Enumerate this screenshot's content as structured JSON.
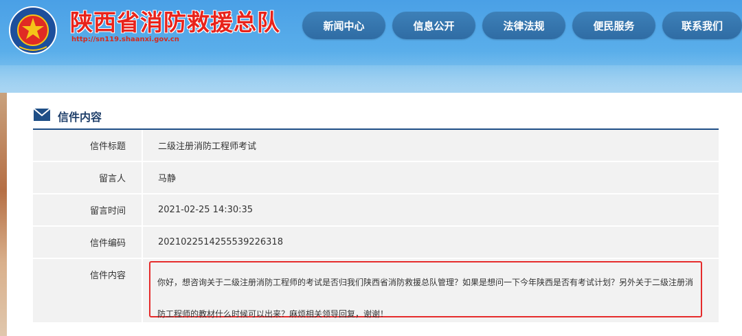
{
  "header": {
    "title": "陕西省消防救援总队",
    "url": "http://sn119.shaanxi.gov.cn",
    "emblem_text": "中国消防救援 CHINA FIRE AND RESCUE"
  },
  "nav": {
    "items": [
      "新闻中心",
      "信息公开",
      "法律法规",
      "便民服务",
      "联系我们"
    ]
  },
  "section": {
    "title": "信件内容",
    "icon": "mail-icon"
  },
  "letter": {
    "rows": [
      {
        "label": "信件标题",
        "value": "二级注册消防工程师考试"
      },
      {
        "label": "留言人",
        "value": "马静"
      },
      {
        "label": "留言时间",
        "value": "2021-02-25 14:30:35"
      },
      {
        "label": "信件编码",
        "value": "20210225142555392263​18"
      }
    ],
    "content_label": "信件内容",
    "content": "你好，想咨询关于二级注册消防工程师的考试是否归我们陕西省消防救援总队管理？如果是想问一下今年陕西是否有考试计划？另外关于二级注册消防工程师的教材什么时候可以出来？麻烦相关领导回复，谢谢！"
  },
  "colors": {
    "header_blue": "#4aa0e6",
    "nav_button": "#3474ae",
    "title_red": "#e8231b",
    "highlight_border": "#e52b2b",
    "section_line": "#1e4e86"
  }
}
